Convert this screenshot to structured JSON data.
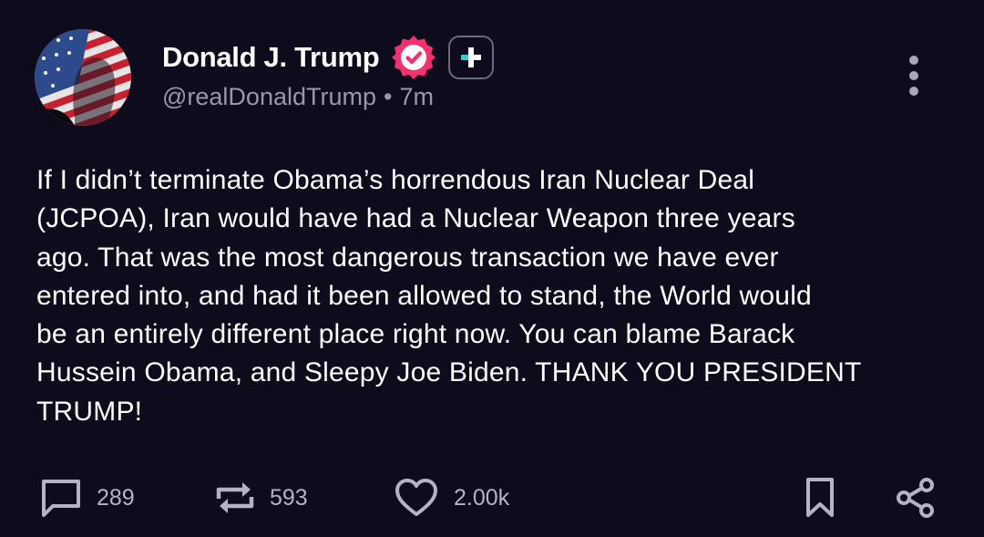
{
  "post": {
    "author": {
      "display_name": "Donald J. Trump",
      "handle": "@realDonaldTrump",
      "verified_icon": "verified-check-badge",
      "verified_color": "#f5306f",
      "follow_icon": "plus-icon"
    },
    "time_separator": "•",
    "time_ago": "7m",
    "body": "If I didn’t terminate Obama’s horrendous Iran Nuclear Deal\n(JCPOA), Iran would have had a Nuclear Weapon three years\nago. That was the most dangerous transaction we have ever\nentered into, and had it been allowed to stand, the World would\nbe an entirely different place right now. You can blame Barack\nHussein Obama, and Sleepy Joe Biden. THANK YOU PRESIDENT\nTRUMP!",
    "actions": {
      "reply_count": "289",
      "retruth_count": "593",
      "like_count": "2.00k"
    }
  },
  "colors": {
    "background": "#0d0b1c",
    "text": "#ffffff",
    "muted": "#9a98a8",
    "icon": "#b5b3c2",
    "accent": "#2ecfd0"
  }
}
